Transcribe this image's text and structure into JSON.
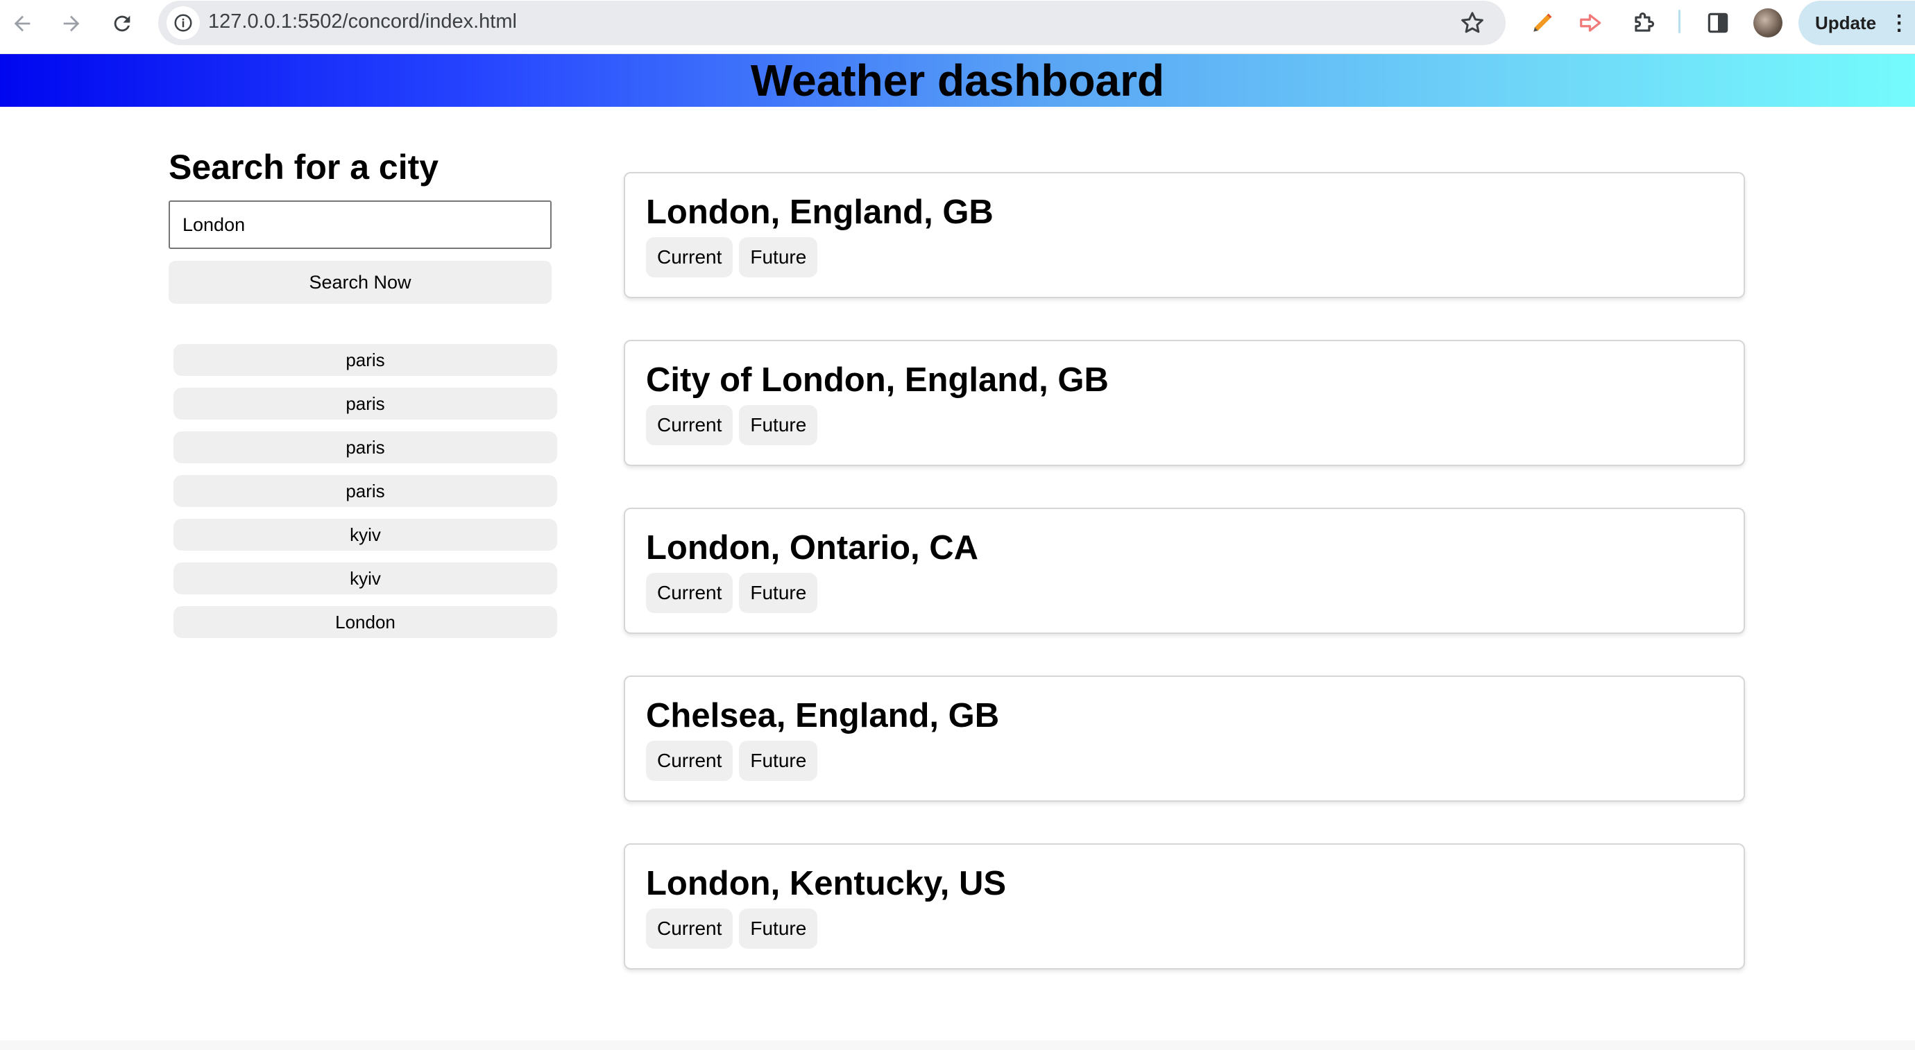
{
  "browser": {
    "url": "127.0.0.1:5502/concord/index.html",
    "update_label": "Update",
    "icons": [
      "back-arrow-icon",
      "forward-arrow-icon",
      "reload-icon",
      "info-icon",
      "star-icon",
      "pencil-icon",
      "extension-arrow-icon",
      "puzzle-icon",
      "side-panel-icon",
      "avatar",
      "more-icon"
    ],
    "colors": {
      "update_bg": "#cfe7f3",
      "omnibox_bg": "#e8eaed"
    }
  },
  "header": {
    "title": "Weather dashboard",
    "gradient": [
      "#0007f0",
      "#2645ff",
      "#5aa6f5",
      "#74fbfd"
    ]
  },
  "search": {
    "title": "Search for a city",
    "input_value": "London",
    "button_label": "Search Now"
  },
  "history": [
    {
      "label": "paris"
    },
    {
      "label": "paris"
    },
    {
      "label": "paris"
    },
    {
      "label": "paris"
    },
    {
      "label": "kyiv"
    },
    {
      "label": "kyiv"
    },
    {
      "label": "London"
    }
  ],
  "results": [
    {
      "name": "London, England, GB",
      "current_label": "Current",
      "future_label": "Future"
    },
    {
      "name": "City of London, England, GB",
      "current_label": "Current",
      "future_label": "Future"
    },
    {
      "name": "London, Ontario, CA",
      "current_label": "Current",
      "future_label": "Future"
    },
    {
      "name": "Chelsea, England, GB",
      "current_label": "Current",
      "future_label": "Future"
    },
    {
      "name": "London, Kentucky, US",
      "current_label": "Current",
      "future_label": "Future"
    }
  ]
}
